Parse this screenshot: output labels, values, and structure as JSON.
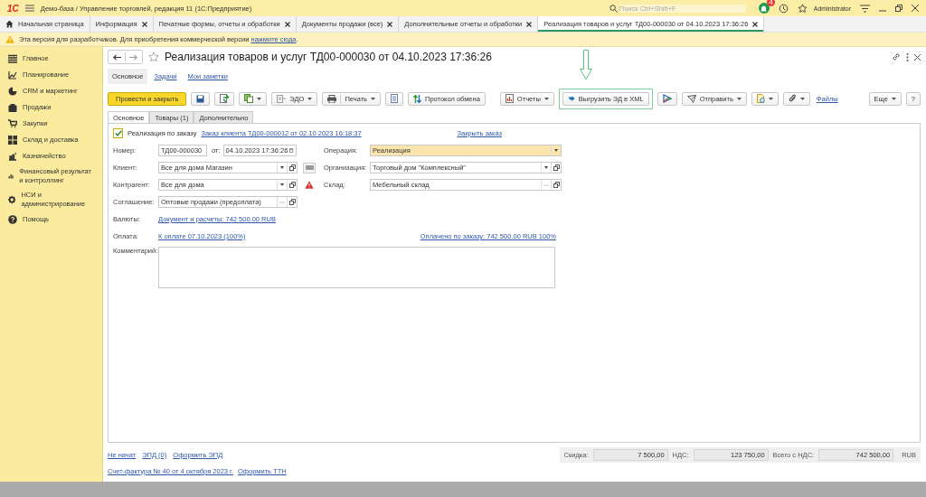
{
  "app": {
    "logo": "1С",
    "title": "Демо-база / Управление торговлей, редакция 11  (1С:Предприятие)",
    "search_placeholder": "Поиск Ctrl+Shift+F",
    "notifications": "4",
    "user": "Administrator"
  },
  "tabs": [
    {
      "label": "Начальная страница",
      "home": true,
      "selected": false
    },
    {
      "label": "Информация",
      "home": false,
      "selected": false
    },
    {
      "label": "Печатные формы, отчеты и обработки",
      "home": false,
      "selected": false
    },
    {
      "label": "Документы продажи (все)",
      "home": false,
      "selected": false
    },
    {
      "label": "Дополнительные отчеты и обработки",
      "home": false,
      "selected": false
    },
    {
      "label": "Реализация товаров и услуг ТД00-000030 от 04.10.2023 17:36:26",
      "home": false,
      "selected": true
    }
  ],
  "notice": {
    "text": "Эта версия для разработчиков. Для приобретения коммерческой версии ",
    "link": "нажмите сюда",
    "suffix": "."
  },
  "sidebar": {
    "items": [
      {
        "label": "Главное",
        "kind": "menu"
      },
      {
        "label": "Планирование",
        "kind": "planning"
      },
      {
        "label": "CRM и маркетинг",
        "kind": "crm"
      },
      {
        "label": "Продажи",
        "kind": "sales"
      },
      {
        "label": "Закупки",
        "kind": "purchases"
      },
      {
        "label": "Склад и доставка",
        "kind": "warehouse"
      },
      {
        "label": "Казначейство",
        "kind": "treasury"
      },
      {
        "label": "Финансовый результат и контроллинг",
        "kind": "finance"
      },
      {
        "label": "НСИ и администрирование",
        "kind": "settings"
      },
      {
        "label": "Помощь",
        "kind": "help"
      }
    ]
  },
  "document": {
    "title": "Реализация товаров и услуг ТД00-000030 от 04.10.2023 17:36:26",
    "sections": [
      {
        "label": "Основное",
        "selected": true
      },
      {
        "label": "Задачи",
        "selected": false
      },
      {
        "label": "Мои заметки",
        "selected": false
      }
    ],
    "toolbar": [
      {
        "kind": "primary",
        "label": "Провести и закрыть"
      },
      {
        "kind": "save"
      },
      {
        "kind": "post"
      },
      {
        "kind": "create",
        "dropdown": true
      },
      {
        "kind": "edo",
        "label": "ЭДО",
        "dropdown": true
      },
      {
        "kind": "print",
        "label": "Печать",
        "dropdown": true
      },
      {
        "kind": "list"
      },
      {
        "kind": "exchange",
        "label": "Протокол обмена"
      },
      {
        "kind": "spacer"
      },
      {
        "kind": "reports",
        "label": "Отчеты",
        "dropdown": true
      },
      {
        "kind": "export",
        "label": "Выгрузить ЭД в XML",
        "highlighted": true
      },
      {
        "kind": "share"
      },
      {
        "kind": "send",
        "label": "Отправить",
        "dropdown": true
      },
      {
        "kind": "doc",
        "dropdown": true
      },
      {
        "kind": "attach",
        "dropdown": true
      },
      {
        "kind": "link",
        "label": "Файлы"
      }
    ],
    "toolbar_right": [
      {
        "label": "Еще",
        "dropdown": true
      },
      {
        "label": "?",
        "dropdown": false
      }
    ],
    "form_tabs": [
      {
        "label": "Основное",
        "selected": true
      },
      {
        "label": "Товары (1)",
        "selected": false
      },
      {
        "label": "Дополнительно",
        "selected": false
      }
    ],
    "by_order": {
      "label": "Реализация по заказу",
      "checked": true,
      "order_link": "Заказ клиента ТД00-000012 от 02.10.2023 16:18:37",
      "close_link": "Закрыть заказ"
    },
    "fields_left": [
      {
        "label": "Номер:",
        "value": "ТД00-000030",
        "kind": "number",
        "date_label": "от:",
        "date_value": "04.10.2023 17:36:26"
      },
      {
        "label": "Клиент:",
        "value": "Все для дома Магазин",
        "kind": "select",
        "action_button": true,
        "warning": false
      },
      {
        "label": "Контрагент:",
        "value": "Все для дома",
        "kind": "select",
        "action_button": false,
        "warning": true
      },
      {
        "label": "Соглашение:",
        "value": "Оптовые продажи (предоплата)",
        "kind": "choose"
      }
    ],
    "fields_right": [
      {
        "label": "Операция:",
        "value": "Реализация",
        "kind": "dropdown",
        "highlighted": true
      },
      {
        "label": "Организация:",
        "value": "Торговый дом \"Комплексный\"",
        "kind": "select",
        "highlighted": false
      },
      {
        "label": "Склад:",
        "value": "Мебельный склад",
        "kind": "choose",
        "highlighted": false
      }
    ],
    "currency": {
      "label": "Валюты:",
      "link": "Документ и расчеты: 742 500.00 RUB"
    },
    "payment": {
      "label": "Оплата:",
      "link": "К оплате 07.10.2023 (100%)",
      "paid_link": "Оплачено по заказу: 742 500.00 RUB 100%"
    },
    "comment": {
      "label": "Комментарий:"
    },
    "footer_links": [
      "Не начат",
      "ЭПД (0)",
      "Оформить ЭПД"
    ],
    "footer_links_2": [
      "Счет-фактура № 40 от 4 октября 2023 г.",
      "Оформить ТТН"
    ],
    "totals": [
      {
        "label": "Скидка:",
        "value": "7 500,00"
      },
      {
        "label": "НДС:",
        "value": "123 750,00"
      },
      {
        "label": "Всего с НДС:",
        "value": "742 500,00"
      }
    ],
    "currency_code": "RUB"
  }
}
